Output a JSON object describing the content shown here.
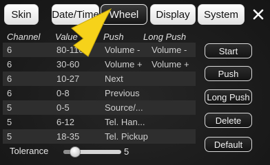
{
  "tabs": [
    "Skin",
    "Date/Time",
    "Wheel",
    "Display",
    "System"
  ],
  "active_tab": "Wheel",
  "close_icon": "close-icon",
  "table": {
    "headers": [
      "Channel",
      "Value",
      "Push",
      "Long Push"
    ],
    "rows": [
      {
        "channel": "6",
        "value": "80-110",
        "push": "Volume -",
        "long_push": "Volume -"
      },
      {
        "channel": "6",
        "value": "30-60",
        "push": "Volume +",
        "long_push": "Volume +"
      },
      {
        "channel": "6",
        "value": "10-27",
        "push": "Next",
        "long_push": ""
      },
      {
        "channel": "6",
        "value": "0-8",
        "push": "Previous",
        "long_push": ""
      },
      {
        "channel": "5",
        "value": "0-5",
        "push": "Source/...",
        "long_push": ""
      },
      {
        "channel": "5",
        "value": "6-12",
        "push": "Tel. Han...",
        "long_push": ""
      },
      {
        "channel": "5",
        "value": "18-35",
        "push": "Tel. Pickup",
        "long_push": ""
      }
    ]
  },
  "buttons": {
    "start": "Start",
    "push": "Push",
    "long_push": "Long Push",
    "delete": "Delete",
    "default": "Default"
  },
  "tolerance": {
    "label": "Tolerance",
    "value": "5",
    "level_fraction": 0.2
  },
  "colors": {
    "accent_arrow": "#f6d21a",
    "background": "#1c1c1c"
  }
}
